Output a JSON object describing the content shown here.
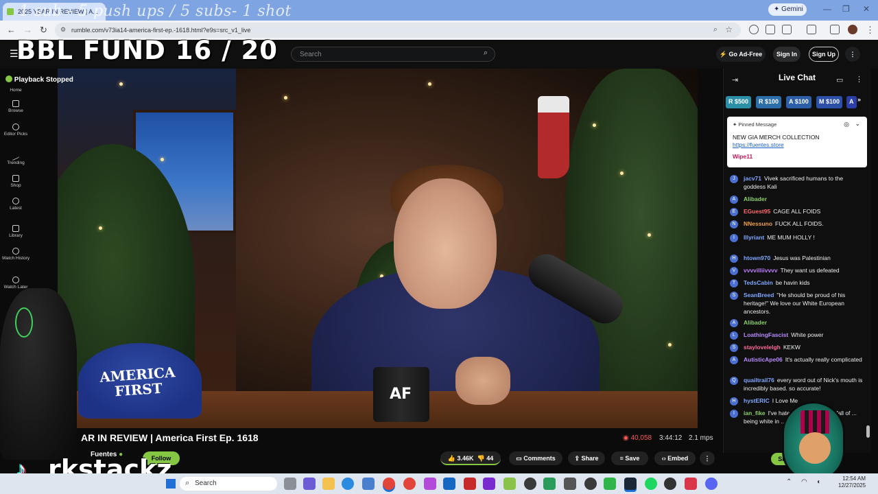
{
  "browser": {
    "tab_title": "2025 YEAR IN REVIEW | A...",
    "overlay_subtitle": "1 sub - 5 push ups / 5 subs- 1 shot",
    "url": "rumble.com/v73ia14-america-first-ep.-1618.html?e9s=src_v1_live",
    "gemini_label": "Gemini"
  },
  "overlay": {
    "bbl_fund": "BBL FUND  16 / 20",
    "streamer_name": "rkstackz"
  },
  "header": {
    "search_placeholder": "Search",
    "go_ad_free": "Go Ad-Free",
    "sign_in": "Sign In",
    "sign_up": "Sign Up"
  },
  "player": {
    "status": "Playback Stopped",
    "cap_text_line1": "AMERICA",
    "cap_text_line2": "FIRST",
    "mug_text": "AF"
  },
  "sidebar": {
    "items": [
      {
        "label": "Home",
        "icon": "home-icon"
      },
      {
        "label": "Browse",
        "icon": "browse-icon"
      },
      {
        "label": "Editor Picks",
        "icon": "editor-picks-icon"
      },
      {
        "label": "Trending",
        "icon": "trending-icon"
      },
      {
        "label": "Shop",
        "icon": "shop-icon"
      },
      {
        "label": "Latest",
        "icon": "clock-icon"
      },
      {
        "label": "Library",
        "icon": "library-icon"
      },
      {
        "label": "Watch History",
        "icon": "history-icon"
      },
      {
        "label": "Watch Later",
        "icon": "watch-later-icon"
      }
    ]
  },
  "video": {
    "title": "AR IN REVIEW | America First Ep. 1618",
    "channel": "Fuentes",
    "follow": "Follow",
    "views": "40,058",
    "duration": "3:44:12",
    "bitrate": "2.1 mps",
    "likes": "3.46K",
    "dislikes": "44",
    "comments": "Comments",
    "share": "Share",
    "save": "Save",
    "embed": "Embed"
  },
  "chat": {
    "title": "Live Chat",
    "rants": [
      {
        "badge": "R",
        "amount": "$500"
      },
      {
        "badge": "R",
        "amount": "$100"
      },
      {
        "badge": "A",
        "amount": "$100"
      },
      {
        "badge": "M",
        "amount": "$100"
      },
      {
        "badge": "A",
        "amount": ""
      }
    ],
    "pinned": {
      "label": "Pinned Message",
      "message": "NEW GIA MERCH COLLECTION",
      "link": "https://fuentes.store",
      "user": "Wipe11"
    },
    "messages": [
      {
        "user": "jacv71",
        "text": "Vivek sacrificed humans to the goddess Kali",
        "color": "#7fa7ff",
        "av": "J"
      },
      {
        "user": "Alibader",
        "text": "",
        "color": "#8bd06a",
        "av": "A"
      },
      {
        "user": "EGuest95",
        "text": "CAGE ALL FOIDS",
        "color": "#ff6b6b",
        "av": "E"
      },
      {
        "user": "NNessuno",
        "text": "FUCK ALL FOIDS.",
        "color": "#f0a04b",
        "av": "N"
      },
      {
        "user": "Illyriant",
        "text": "ME  MUM  HOLLY !",
        "color": "#7fa7ff",
        "av": "I"
      },
      {
        "user": "htown970",
        "text": "Jesus was Palestinian",
        "color": "#7fa7ff",
        "av": "H"
      },
      {
        "user": "vvvvilliivvvv",
        "text": "They want us defeated",
        "color": "#c07cff",
        "av": "V"
      },
      {
        "user": "TedsCabin",
        "text": "be havin kids",
        "color": "#7fa7ff",
        "av": "T"
      },
      {
        "user": "SeanBreed",
        "text": "\"He should be proud of his heritage!\" We love our White European ancestors.",
        "color": "#7fa7ff",
        "av": "S"
      },
      {
        "user": "Alibader",
        "text": "",
        "color": "#8bd06a",
        "av": "A"
      },
      {
        "user": "LoathingFascist",
        "text": "White power",
        "color": "#b98cff",
        "av": "L"
      },
      {
        "user": "staylovelelgh",
        "text": "KEKW",
        "color": "#ff6b9a",
        "av": "S"
      },
      {
        "user": "AutisticApe06",
        "text": "It's actually really complicated",
        "color": "#b98cff",
        "av": "A"
      },
      {
        "user": "quailtrail76",
        "text": "every word out of Nick's mouth is incredibly based. so accurate!",
        "color": "#7fa7ff",
        "av": "Q"
      },
      {
        "user": "hystERIC",
        "text": "I Love Me",
        "color": "#7fa7ff",
        "av": "H"
      },
      {
        "user": "ian_fike",
        "text": "I've hated ... and the downfall of ... being white in ... from Hunter Bi...",
        "color": "#8bd06a",
        "av": "I"
      }
    ],
    "sign_in": "Sign"
  },
  "taskbar": {
    "search": "Search",
    "time": "12:54 AM",
    "date": "12/27/2025"
  },
  "colors": {
    "rumble_green": "#85c742",
    "chat_bg": "#0f0f10",
    "taskbar_bg": "#dfe5ee"
  }
}
